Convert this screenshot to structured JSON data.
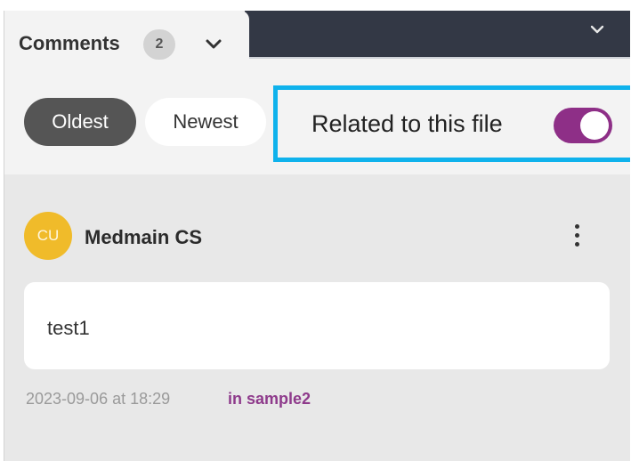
{
  "header": {
    "tab_label": "Comments",
    "comment_count": "2"
  },
  "sort": {
    "oldest_label": "Oldest",
    "newest_label": "Newest",
    "selected": "Oldest"
  },
  "filter": {
    "related_label": "Related to this file",
    "related_enabled": true
  },
  "comments": [
    {
      "avatar_initials": "CU",
      "author": "Medmain CS",
      "text": "test1",
      "timestamp": "2023-09-06 at 18:29",
      "location": "in sample2"
    }
  ],
  "colors": {
    "accent_purple": "#8e2f87",
    "highlight_blue": "#0fb2ec",
    "avatar_yellow": "#f0bb2a",
    "dark_bar": "#333845"
  },
  "icons": {
    "tab_dropdown": "chevron-down-icon",
    "top_dropdown": "chevron-down-icon",
    "comment_menu": "kebab-menu-icon"
  }
}
